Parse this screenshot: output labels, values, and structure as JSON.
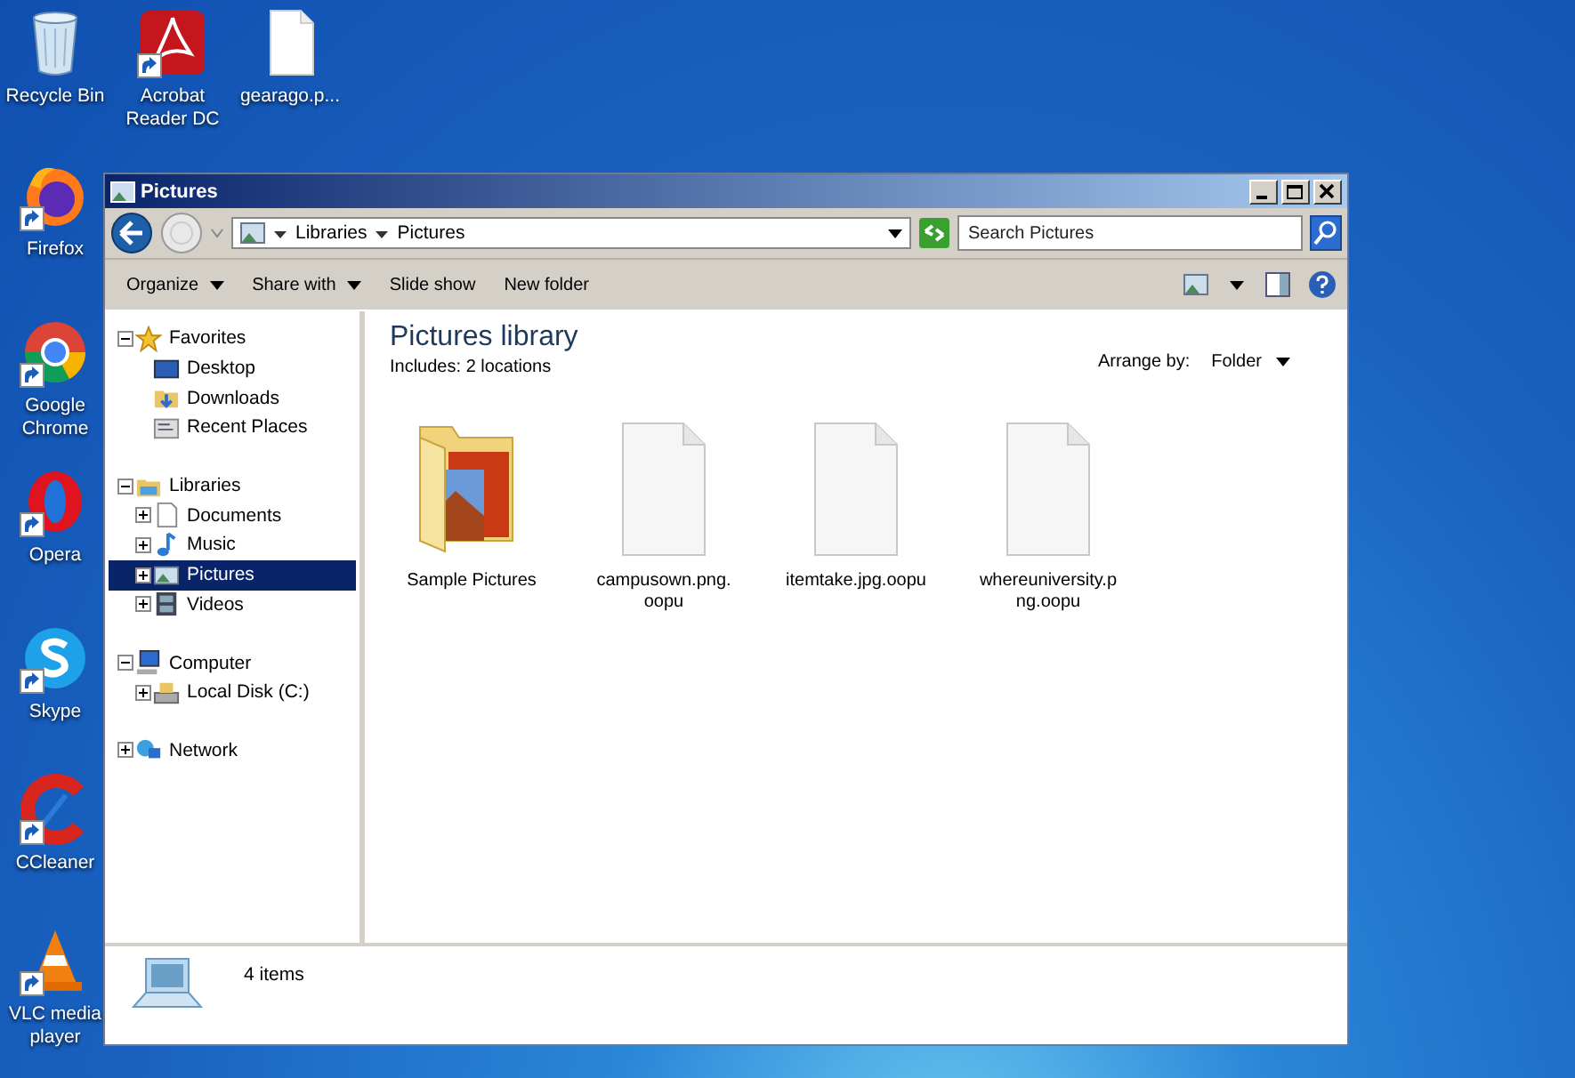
{
  "desktop_icons": [
    {
      "label": "Recycle Bin",
      "shortcut": false
    },
    {
      "label": "Acrobat Reader DC",
      "shortcut": true
    },
    {
      "label": "gearago.p...",
      "shortcut": false
    },
    {
      "label": "Firefox",
      "shortcut": true
    },
    {
      "label": "Google Chrome",
      "shortcut": true
    },
    {
      "label": "Opera",
      "shortcut": true
    },
    {
      "label": "Skype",
      "shortcut": true
    },
    {
      "label": "CCleaner",
      "shortcut": true
    },
    {
      "label": "VLC media player",
      "shortcut": true
    }
  ],
  "window": {
    "title": "Pictures",
    "breadcrumb": [
      "Libraries",
      "Pictures"
    ],
    "search": {
      "placeholder": "Search Pictures"
    },
    "toolbar": [
      {
        "label": "Organize",
        "dropdown": true
      },
      {
        "label": "Share with",
        "dropdown": true
      },
      {
        "label": "Slide show",
        "dropdown": false
      },
      {
        "label": "New folder",
        "dropdown": false
      }
    ],
    "nav_tree": [
      {
        "label": "Favorites",
        "expanded": true,
        "selected": false,
        "children": [
          {
            "label": "Desktop",
            "selected": false
          },
          {
            "label": "Downloads",
            "selected": false
          },
          {
            "label": "Recent Places",
            "selected": false
          }
        ]
      },
      {
        "label": "Libraries",
        "expanded": true,
        "selected": false,
        "children": [
          {
            "label": "Documents",
            "expanded": false,
            "selected": false
          },
          {
            "label": "Music",
            "expanded": false,
            "selected": false
          },
          {
            "label": "Pictures",
            "expanded": false,
            "selected": true
          },
          {
            "label": "Videos",
            "expanded": false,
            "selected": false
          }
        ]
      },
      {
        "label": "Computer",
        "expanded": true,
        "selected": false,
        "children": [
          {
            "label": "Local Disk (C:)",
            "expanded": false,
            "selected": false
          }
        ]
      },
      {
        "label": "Network",
        "expanded": false,
        "selected": false
      }
    ],
    "library": {
      "title": "Pictures library",
      "includes_label": "Includes:",
      "includes_link": "2 locations",
      "arrange_label": "Arrange by:",
      "arrange_value": "Folder"
    },
    "files": [
      {
        "name": "Sample Pictures",
        "kind": "folder"
      },
      {
        "name": "campusown.png.oopu",
        "kind": "file"
      },
      {
        "name": "itemtake.jpg.oopu",
        "kind": "file"
      },
      {
        "name": "whereuniversity.png.oopu",
        "kind": "file"
      }
    ],
    "status_bar": {
      "text": "4 items"
    }
  }
}
